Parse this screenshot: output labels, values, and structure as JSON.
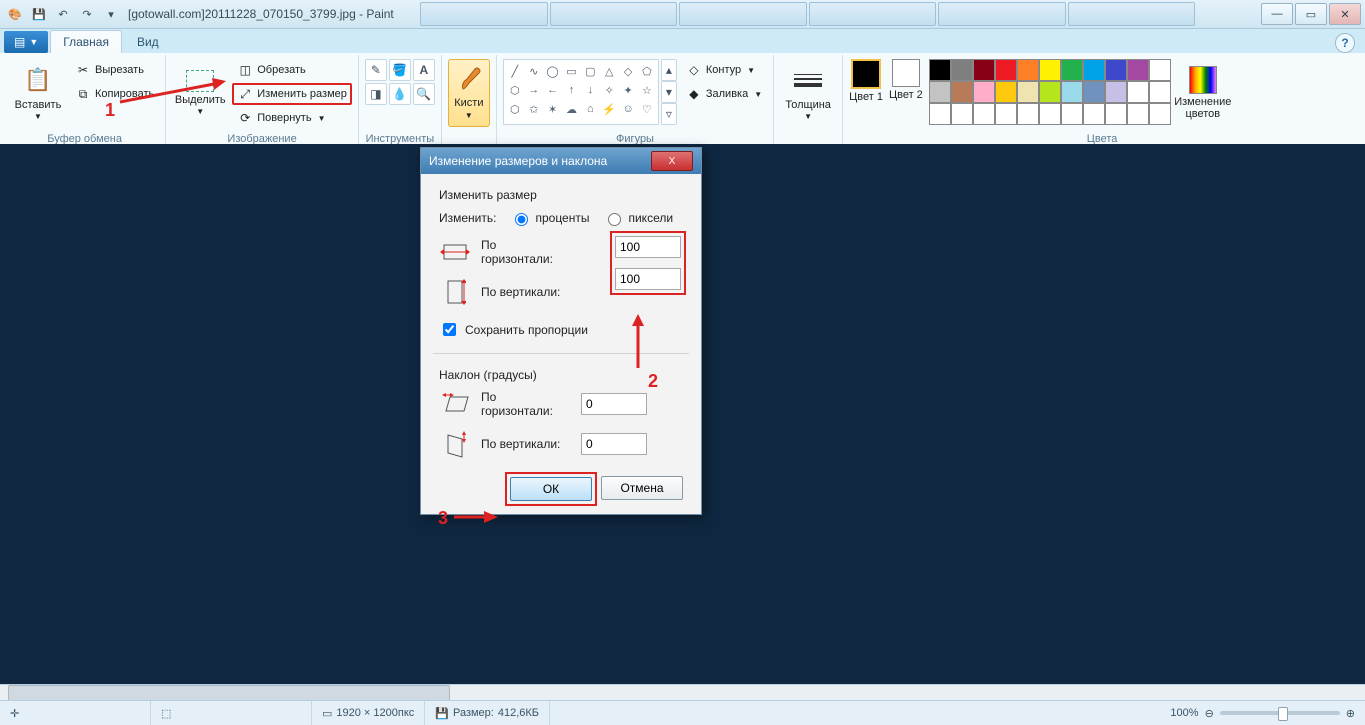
{
  "title": "[gotowall.com]20111228_070150_3799.jpg - Paint",
  "tabs": {
    "file": "",
    "home": "Главная",
    "view": "Вид"
  },
  "annotations": {
    "n1": "1",
    "n2": "2",
    "n3": "3"
  },
  "ribbon": {
    "clipboard": {
      "paste": "Вставить",
      "cut": "Вырезать",
      "copy": "Копировать",
      "label": "Буфер обмена"
    },
    "image": {
      "select": "Выделить",
      "crop": "Обрезать",
      "resize": "Изменить размер",
      "rotate": "Повернуть",
      "label": "Изображение"
    },
    "tools": {
      "label": "Инструменты"
    },
    "brushes": {
      "label": "Кисти"
    },
    "shapes": {
      "outline": "Контур",
      "fill": "Заливка",
      "label": "Фигуры"
    },
    "thickness": {
      "label": "Толщина"
    },
    "colors": {
      "c1": "Цвет 1",
      "c2": "Цвет 2",
      "edit": "Изменение цветов",
      "label": "Цвета",
      "palette": [
        "#000000",
        "#7f7f7f",
        "#880015",
        "#ed1c24",
        "#ff7f27",
        "#fff200",
        "#22b14c",
        "#00a2e8",
        "#3f48cc",
        "#a349a4",
        "#ffffff",
        "#c3c3c3",
        "#b97a57",
        "#ffaec9",
        "#ffc90e",
        "#efe4b0",
        "#b5e61d",
        "#99d9ea",
        "#7092be",
        "#c8bfe7",
        "#ffffff",
        "#ffffff",
        "#ffffff",
        "#ffffff",
        "#ffffff",
        "#ffffff",
        "#ffffff",
        "#ffffff",
        "#ffffff",
        "#ffffff",
        "#ffffff",
        "#ffffff",
        "#ffffff"
      ]
    }
  },
  "dialog": {
    "title": "Изменение размеров и наклона",
    "resize_header": "Изменить размер",
    "by_label": "Изменить:",
    "opt_percent": "проценты",
    "opt_pixels": "пиксели",
    "horizontal": "По горизонтали:",
    "vertical": "По вертикали:",
    "h_val": "100",
    "v_val": "100",
    "keep_ratio": "Сохранить пропорции",
    "skew_header": "Наклон (градусы)",
    "skew_h": "По горизонтали:",
    "skew_v": "По вертикали:",
    "skew_h_val": "0",
    "skew_v_val": "0",
    "ok": "ОК",
    "cancel": "Отмена",
    "close": "X"
  },
  "status": {
    "dims": "1920 × 1200пкс",
    "size_label": "Размер:",
    "size_val": "412,6КБ",
    "zoom": "100%"
  }
}
